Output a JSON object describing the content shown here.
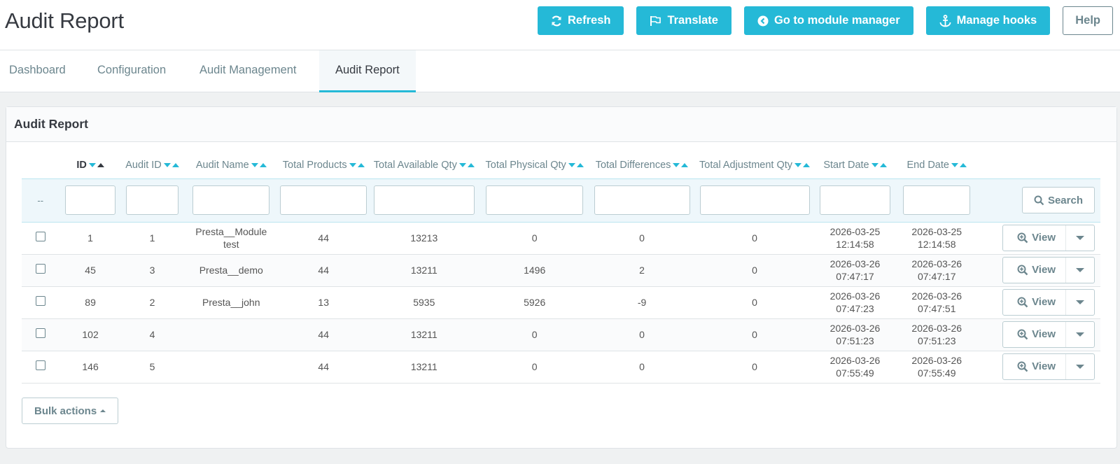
{
  "page": {
    "title": "Audit Report"
  },
  "toolbar": {
    "refresh_label": "Refresh",
    "translate_label": "Translate",
    "module_manager_label": "Go to module manager",
    "manage_hooks_label": "Manage hooks",
    "help_label": "Help"
  },
  "tabs": [
    {
      "label": "Dashboard"
    },
    {
      "label": "Configuration"
    },
    {
      "label": "Audit Management"
    },
    {
      "label": "Audit Report"
    }
  ],
  "panel": {
    "title": "Audit Report"
  },
  "table": {
    "headers": [
      "ID",
      "Audit ID",
      "Audit Name",
      "Total Products",
      "Total Available Qty",
      "Total Physical Qty",
      "Total Differences",
      "Total Adjustment Qty",
      "Start Date",
      "End Date"
    ],
    "filter_placeholder": "--",
    "search_label": "Search",
    "view_label": "View",
    "rows": [
      {
        "id": "1",
        "audit_id": "1",
        "audit_name": "Presta__Module test",
        "total_products": "44",
        "available_qty": "13213",
        "physical_qty": "0",
        "differences": "0",
        "adjustment_qty": "0",
        "start_date": "2026-03-25",
        "start_time": "12:14:58",
        "end_date": "2026-03-25",
        "end_time": "12:14:58"
      },
      {
        "id": "45",
        "audit_id": "3",
        "audit_name": "Presta__demo",
        "total_products": "44",
        "available_qty": "13211",
        "physical_qty": "1496",
        "differences": "2",
        "adjustment_qty": "0",
        "start_date": "2026-03-26",
        "start_time": "07:47:17",
        "end_date": "2026-03-26",
        "end_time": "07:47:17"
      },
      {
        "id": "89",
        "audit_id": "2",
        "audit_name": "Presta__john",
        "total_products": "13",
        "available_qty": "5935",
        "physical_qty": "5926",
        "differences": "-9",
        "adjustment_qty": "0",
        "start_date": "2026-03-26",
        "start_time": "07:47:23",
        "end_date": "2026-03-26",
        "end_time": "07:47:51"
      },
      {
        "id": "102",
        "audit_id": "4",
        "audit_name": "",
        "total_products": "44",
        "available_qty": "13211",
        "physical_qty": "0",
        "differences": "0",
        "adjustment_qty": "0",
        "start_date": "2026-03-26",
        "start_time": "07:51:23",
        "end_date": "2026-03-26",
        "end_time": "07:51:23"
      },
      {
        "id": "146",
        "audit_id": "5",
        "audit_name": "",
        "total_products": "44",
        "available_qty": "13211",
        "physical_qty": "0",
        "differences": "0",
        "adjustment_qty": "0",
        "start_date": "2026-03-26",
        "start_time": "07:55:49",
        "end_date": "2026-03-26",
        "end_time": "07:55:49"
      }
    ]
  },
  "bulk_actions_label": "Bulk actions",
  "colors": {
    "accent": "#25b9d7",
    "text": "#363a41",
    "muted": "#6c868e"
  }
}
